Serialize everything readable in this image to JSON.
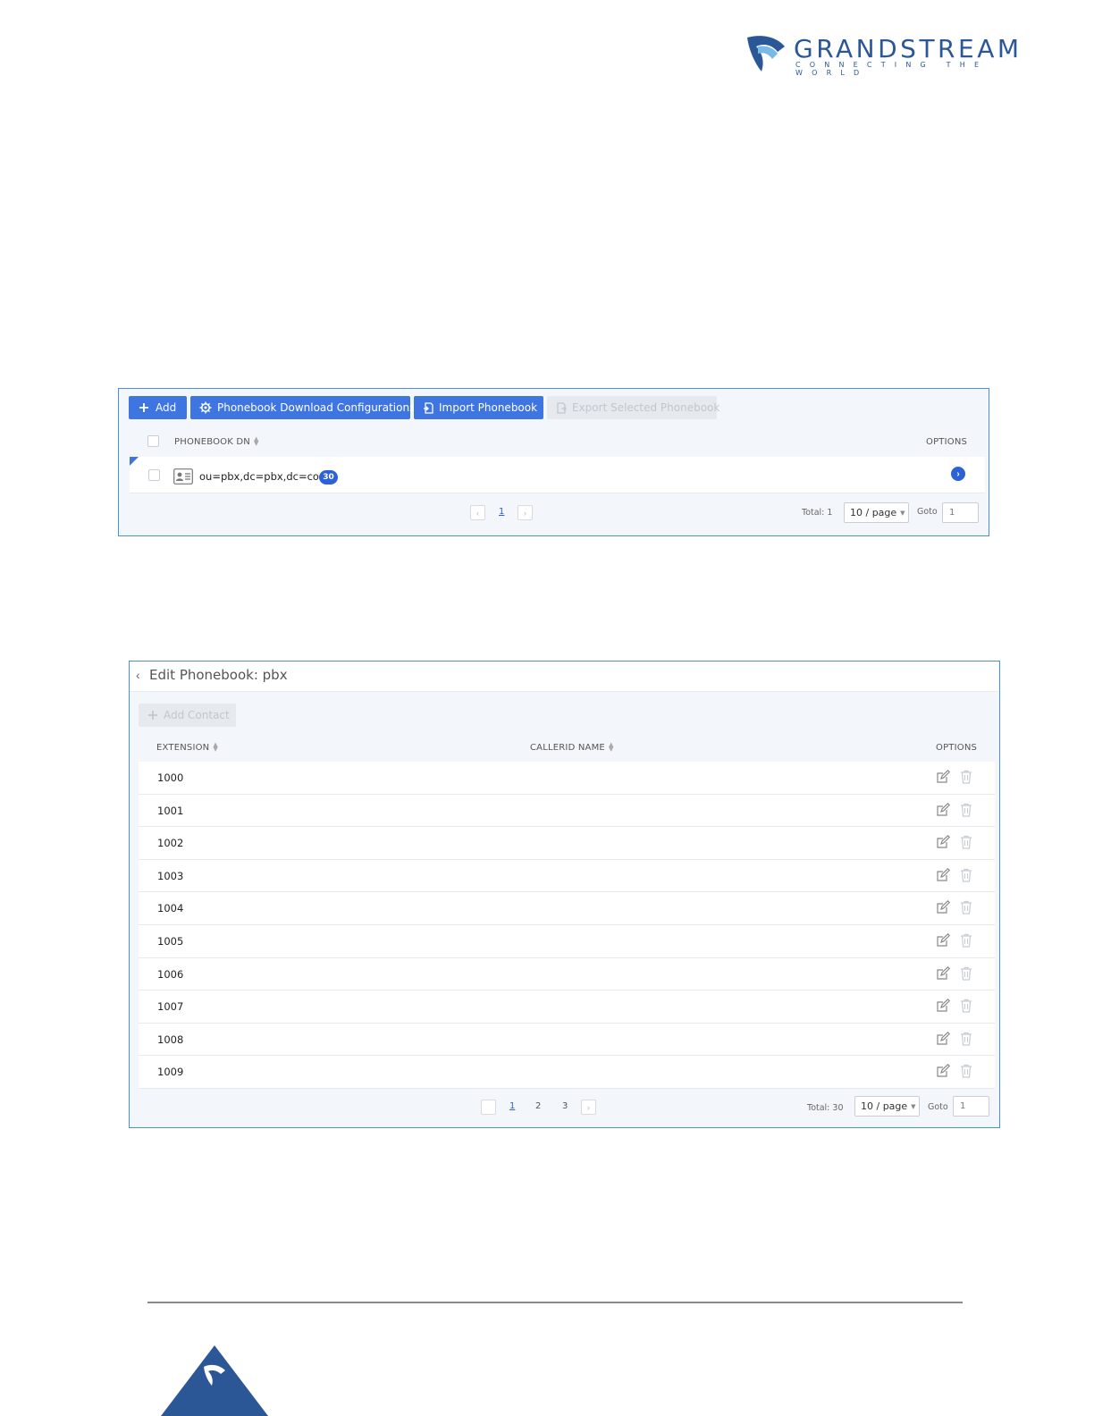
{
  "brand": {
    "name": "GRANDSTREAM",
    "tagline": "CONNECTING THE WORLD",
    "primary_color": "#2b5797",
    "accent_color": "#3f75e0"
  },
  "phonebook_panel": {
    "toolbar": {
      "add_label": "Add",
      "download_config_label": "Phonebook Download Configurations",
      "import_label": "Import Phonebook",
      "export_label": "Export Selected Phonebook"
    },
    "columns": {
      "dn": "PHONEBOOK DN",
      "options": "OPTIONS"
    },
    "rows": [
      {
        "dn": "ou=pbx,dc=pbx,dc=com",
        "count": "30"
      }
    ],
    "pagination": {
      "current_page": "1",
      "total_label": "Total: 1",
      "page_size": "10 / page",
      "goto_label": "Goto",
      "goto_value": "1"
    }
  },
  "edit_panel": {
    "title": "Edit Phonebook: pbx",
    "add_contact_label": "Add Contact",
    "columns": {
      "extension": "EXTENSION",
      "callerid": "CALLERID NAME",
      "options": "OPTIONS"
    },
    "rows": [
      {
        "extension": "1000",
        "callerid": ""
      },
      {
        "extension": "1001",
        "callerid": ""
      },
      {
        "extension": "1002",
        "callerid": ""
      },
      {
        "extension": "1003",
        "callerid": ""
      },
      {
        "extension": "1004",
        "callerid": ""
      },
      {
        "extension": "1005",
        "callerid": ""
      },
      {
        "extension": "1006",
        "callerid": ""
      },
      {
        "extension": "1007",
        "callerid": ""
      },
      {
        "extension": "1008",
        "callerid": ""
      },
      {
        "extension": "1009",
        "callerid": ""
      }
    ],
    "pagination": {
      "pages": [
        "1",
        "2",
        "3"
      ],
      "total_label": "Total: 30",
      "page_size": "10 / page",
      "goto_label": "Goto",
      "goto_value": "1"
    }
  }
}
